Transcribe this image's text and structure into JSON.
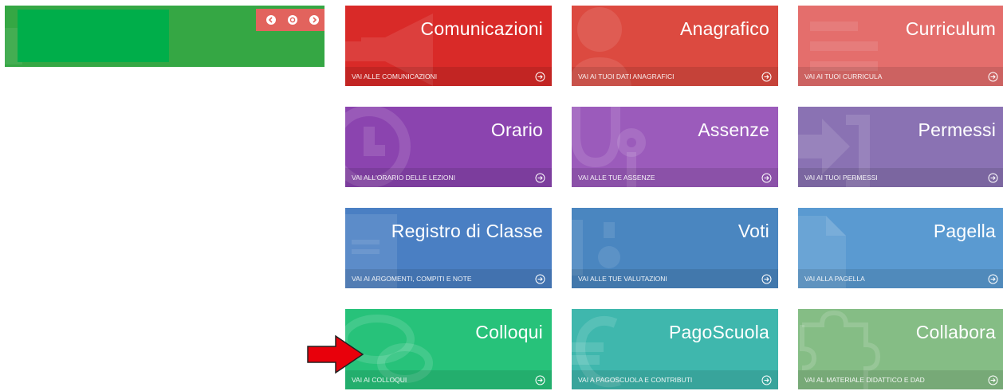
{
  "header": {
    "brand_color": "#00ae4a",
    "nav": [
      {
        "icon": "arrow-left-circle-icon"
      },
      {
        "icon": "target-circle-icon"
      },
      {
        "icon": "arrow-right-circle-icon"
      }
    ]
  },
  "tiles": [
    {
      "title": "Comunicazioni",
      "link": "VAI ALLE COMUNICAZIONI",
      "color": "#d92a28",
      "icon": "megaphone-icon"
    },
    {
      "title": "Anagrafico",
      "link": "VAI AI TUOI DATI ANAGRAFICI",
      "color": "#dc4a40",
      "icon": "person-icon"
    },
    {
      "title": "Curriculum",
      "link": "VAI AI TUOI CURRICULA",
      "color": "#e46e6c",
      "icon": "document-lines-icon"
    },
    {
      "title": "Orario",
      "link": "VAI ALL'ORARIO DELLE LEZIONI",
      "color": "#8b44af",
      "icon": "clock-icon"
    },
    {
      "title": "Assenze",
      "link": "VAI ALLE TUE ASSENZE",
      "color": "#9b5bbb",
      "icon": "stethoscope-icon"
    },
    {
      "title": "Permessi",
      "link": "VAI AI TUOI PERMESSI",
      "color": "#8a72b3",
      "icon": "sign-in-icon"
    },
    {
      "title": "Registro di Classe",
      "link": "VAI AI ARGOMENTI, COMPITI E NOTE",
      "color": "#4a7fc3",
      "icon": "book-icon"
    },
    {
      "title": "Voti",
      "link": "VAI ALLE TUE VALUTAZIONI",
      "color": "#4a86c0",
      "icon": "grades-icon"
    },
    {
      "title": "Pagella",
      "link": "VAI ALLA PAGELLA",
      "color": "#5a9ad1",
      "icon": "file-icon"
    },
    {
      "title": "Colloqui",
      "link": "VAI AI COLLOQUI",
      "color": "#27c27a",
      "icon": "chat-bubbles-icon"
    },
    {
      "title": "PagoScuola",
      "link": "VAI A PAGOSCUOLA E CONTRIBUTI",
      "color": "#3fb7ad",
      "icon": "euro-icon"
    },
    {
      "title": "Collabora",
      "link": "VAI AL MATERIALE DIDATTICO E DAD",
      "color": "#85bd85",
      "icon": "puzzle-icon"
    }
  ],
  "annotation": {
    "icon": "red-pointer-arrow-icon",
    "color": "#e8000b"
  }
}
